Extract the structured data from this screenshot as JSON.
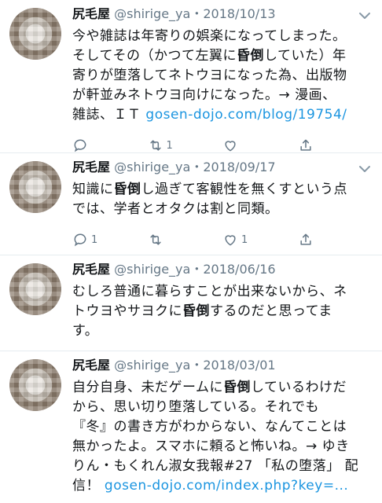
{
  "tweets": [
    {
      "name": "尻毛屋",
      "handle": "@shirige_ya",
      "date": "・2018/10/13",
      "lines": [
        "今や雑誌は年寄りの娯楽になってしまった。",
        "そしてその（かつて左翼に",
        "昏倒",
        "していた）年",
        "寄りが堕落してネトウヨになった為、出版物",
        "が軒並みネトウヨ向けになった。→ 漫画、",
        "雑誌、ＩＴ "
      ],
      "link": "gosen-dojo.com/blog/19754/",
      "reply_count": "",
      "retweet_count": "1",
      "like_count": ""
    },
    {
      "name": "尻毛屋",
      "handle": "@shirige_ya",
      "date": "・2018/09/17",
      "pre": "知識に",
      "bold": "昏倒",
      "post": "し過ぎて客観性を無くすという点",
      "line2": "では、学者とオタクは割と同類。",
      "reply_count": "1",
      "retweet_count": "",
      "like_count": "1"
    },
    {
      "name": "尻毛屋",
      "handle": "@shirige_ya",
      "date": "・2018/06/16",
      "line1": "むしろ普通に暮らすことが出来ないから、ネ",
      "pre": "トウヨやサヨクに",
      "bold": "昏倒",
      "post": "するのだと思ってま",
      "line3": "す。"
    },
    {
      "name": "尻毛屋",
      "handle": "@shirige_ya",
      "date": "・2018/03/01",
      "pre": "自分自身、未だゲームに",
      "bold": "昏倒",
      "post": "しているわけだ",
      "line2": "から、思い切り堕落している。それでも",
      "line3": "『冬』の書き方がわからない、なんてことは",
      "line4": "無かったよ。スマホに頼ると怖いね。→ ゆき",
      "line5": "りん・もくれん淑女我報#27 「私の堕落」 配",
      "line6_pre": "信！ ",
      "link": "gosen-dojo.com/index.php?key=..."
    }
  ]
}
